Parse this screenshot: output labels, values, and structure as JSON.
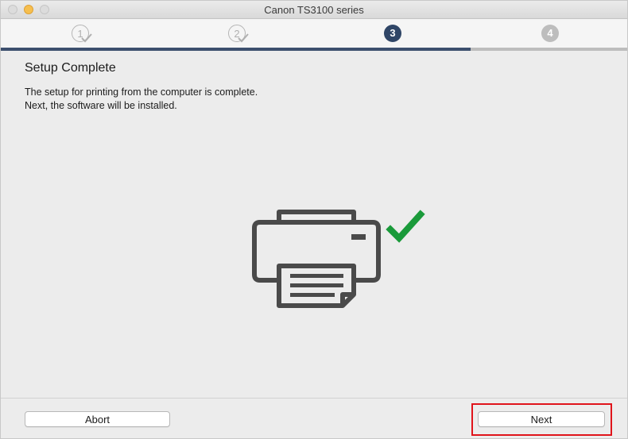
{
  "window": {
    "title": "Canon TS3100 series"
  },
  "steps": [
    {
      "number": "1",
      "state": "done"
    },
    {
      "number": "2",
      "state": "done"
    },
    {
      "number": "3",
      "state": "current"
    },
    {
      "number": "4",
      "state": "future"
    }
  ],
  "progress": {
    "completed_fraction": 0.75
  },
  "content": {
    "heading": "Setup Complete",
    "line1": "The setup for printing from the computer is complete.",
    "line2": "Next, the software will be installed."
  },
  "illustration": {
    "icons": [
      "printer-icon",
      "checkmark-icon"
    ],
    "printer_color": "#4a4a4a",
    "check_color": "#1a9a3a"
  },
  "footer": {
    "abort_label": "Abort",
    "next_label": "Next"
  },
  "colors": {
    "current_step": "#2f4566",
    "future_step": "#bdbdbd",
    "highlight": "#e0141b"
  }
}
